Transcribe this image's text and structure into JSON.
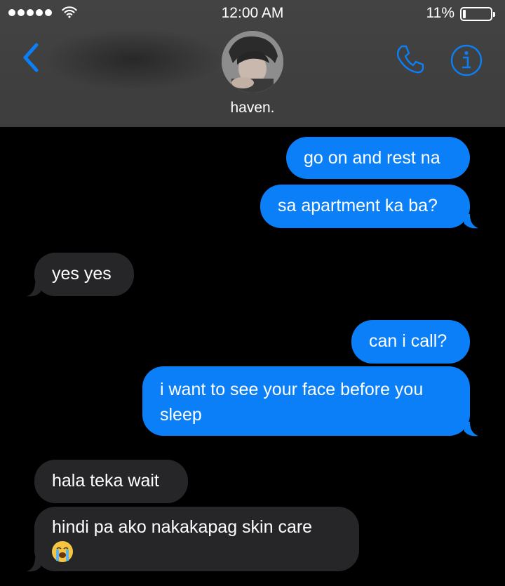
{
  "status_bar": {
    "time": "12:00 AM",
    "battery_percent": "11%",
    "battery_level": 0.11,
    "signal_bars": 5,
    "icons": [
      "signal-dots-icon",
      "wifi-icon",
      "battery-icon"
    ]
  },
  "header": {
    "contact_name": "haven.",
    "icons": [
      "chevron-left-icon",
      "avatar",
      "phone-icon",
      "info-icon"
    ]
  },
  "colors": {
    "accent": "#0b7ff7",
    "sent_bubble": "#0b7ff7",
    "received_bubble": "#262628",
    "header_bg": "#424242",
    "background": "#000000"
  },
  "messages": [
    {
      "from": "me",
      "text": "go on and rest na"
    },
    {
      "from": "me",
      "text": "sa apartment ka ba?"
    },
    {
      "from": "them",
      "text": "yes yes"
    },
    {
      "from": "me",
      "text": "can i call?"
    },
    {
      "from": "me",
      "text": "i want to see your face before you sleep"
    },
    {
      "from": "them",
      "text": "hala teka wait"
    },
    {
      "from": "them",
      "text": "hindi pa ako nakakapag skin care",
      "emoji": "loudly-crying-face-emoji"
    }
  ]
}
